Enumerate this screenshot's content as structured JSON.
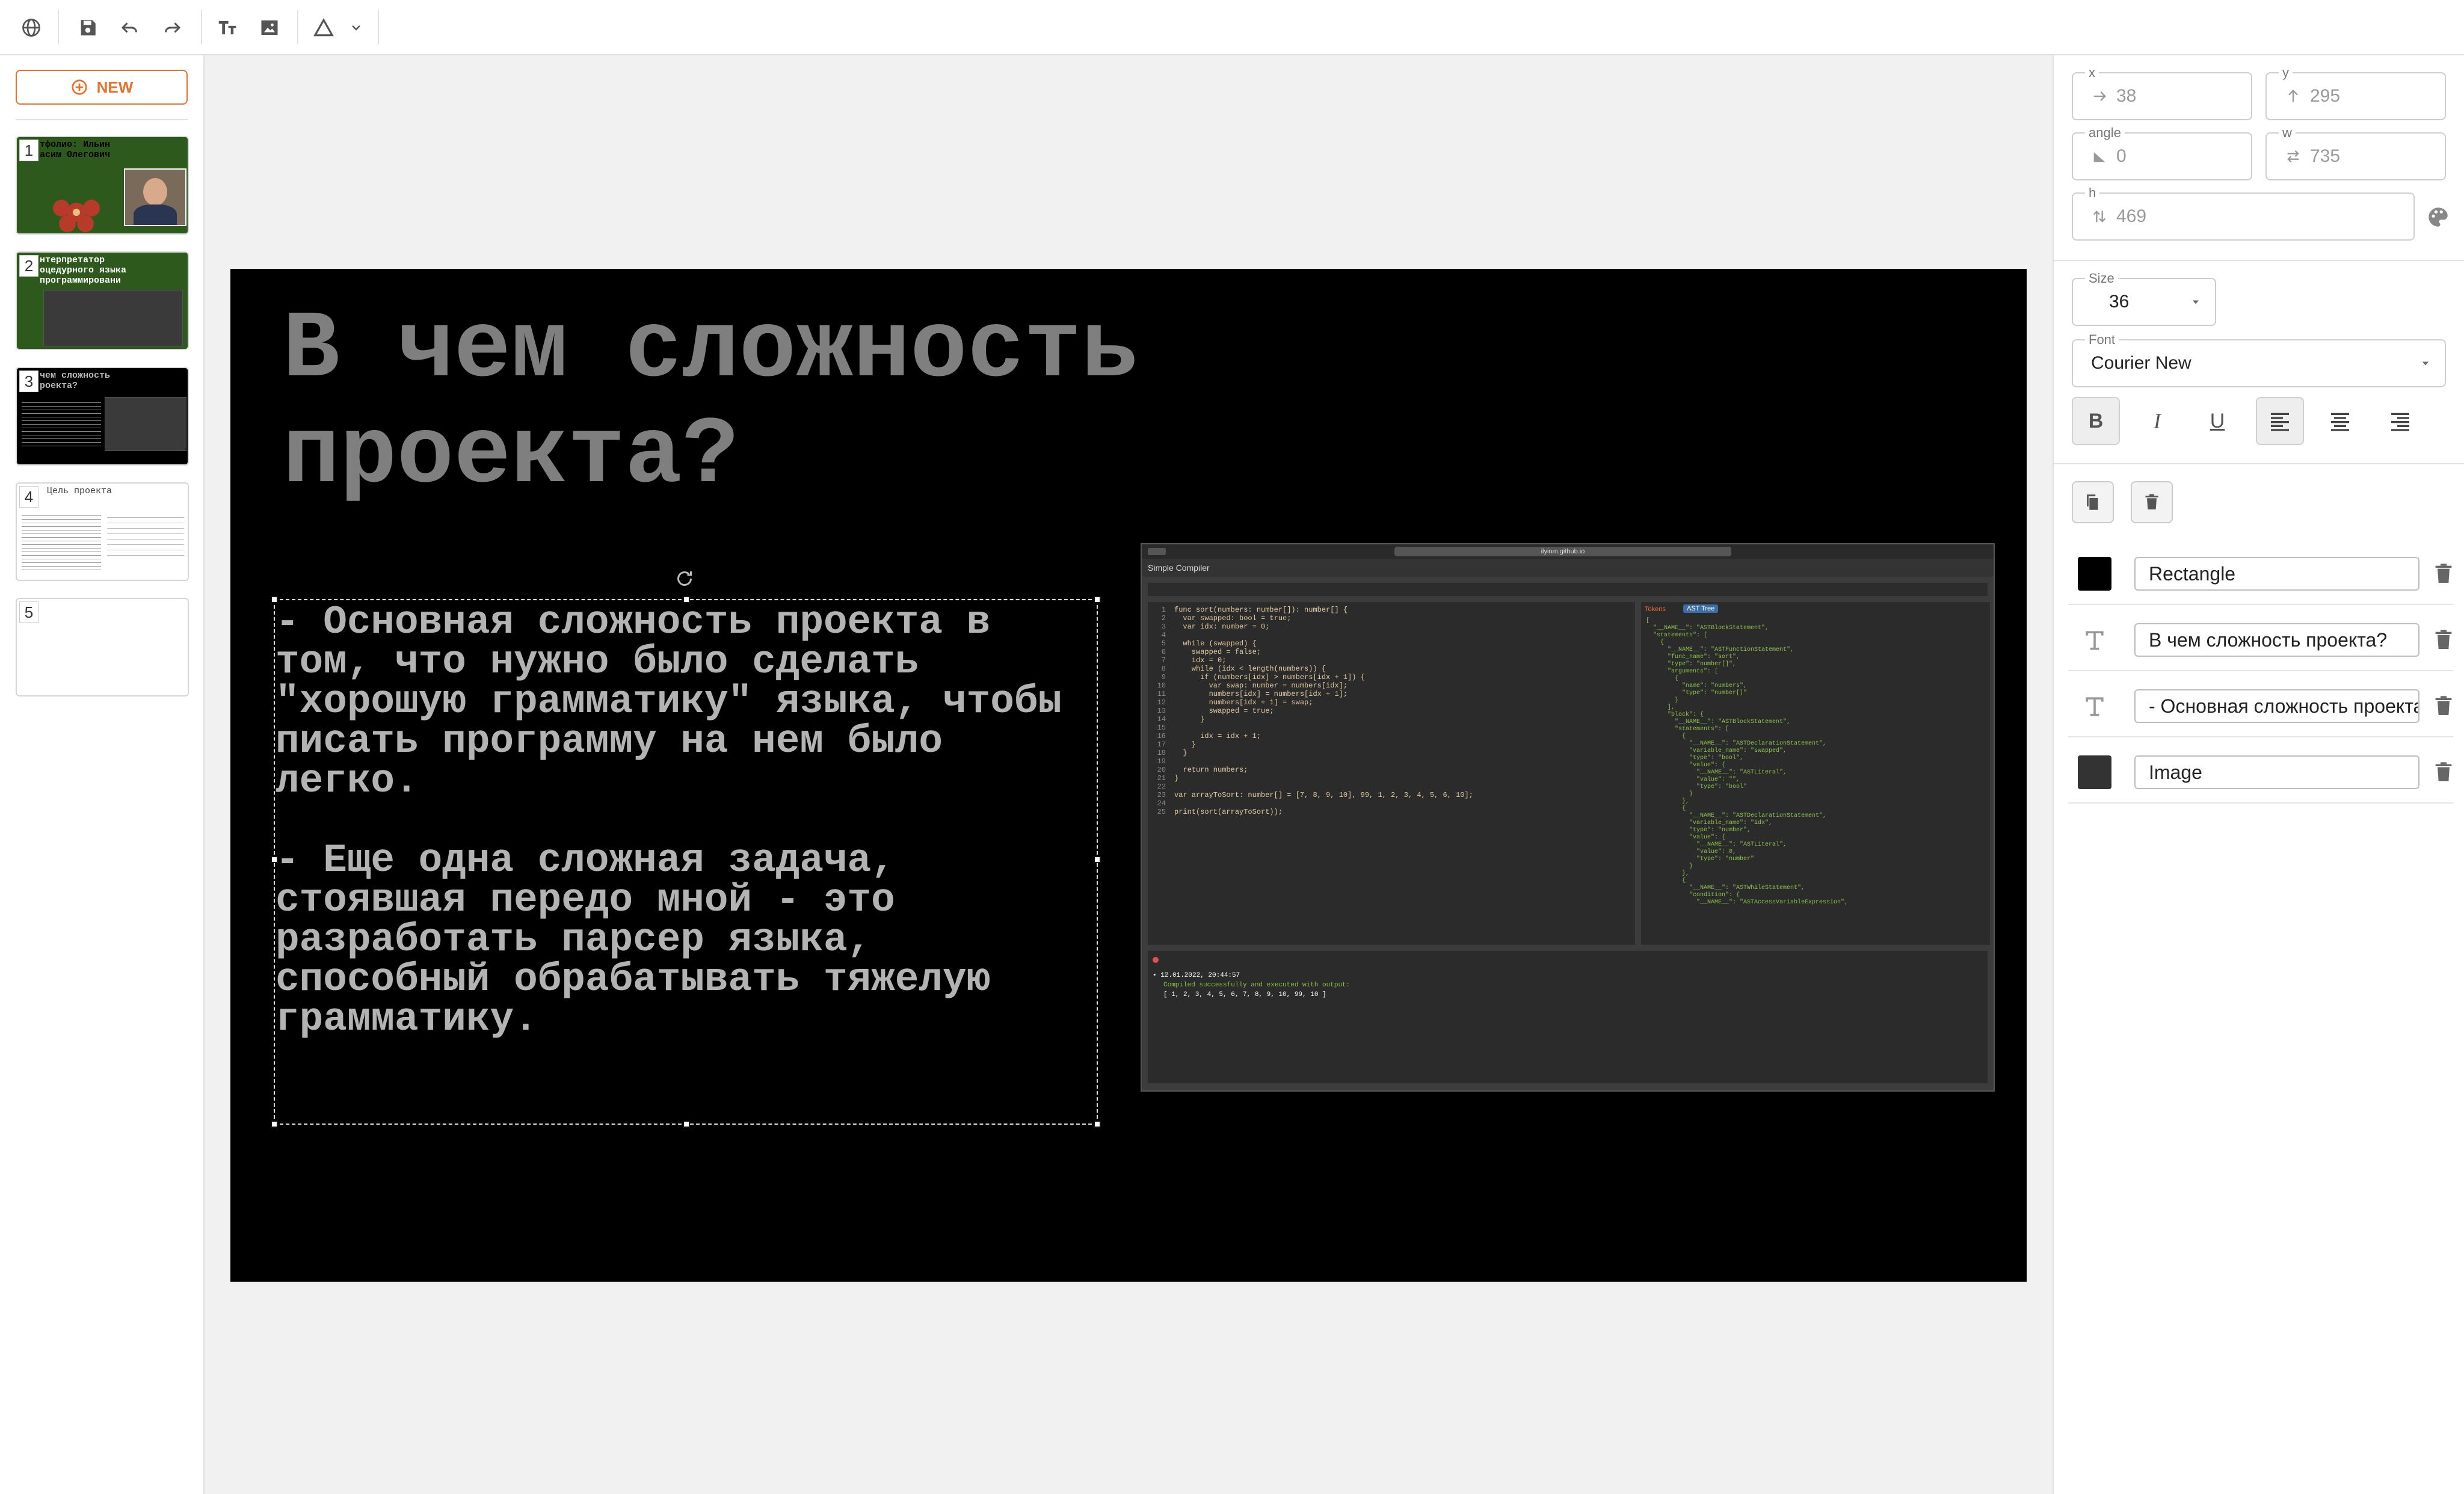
{
  "toolbar": {
    "icons": [
      "globe-icon",
      "save-icon",
      "undo-icon",
      "redo-icon",
      "text-icon",
      "image-icon",
      "shape-icon",
      "chevron-down-icon"
    ]
  },
  "sidebar": {
    "new_label": "NEW",
    "slides": [
      {
        "number": "1",
        "title": "тфолио: Ильин\nасим Олегович",
        "bg": "#2d5a1c"
      },
      {
        "number": "2",
        "title": "нтерпретатор\nоцедурного языка\nпрограммировани",
        "bg": "#2d5a1c"
      },
      {
        "number": "3",
        "title": "чем сложность\nроекта?",
        "bg": "#000000"
      },
      {
        "number": "4",
        "title": "Цель проекта",
        "bg": "#ffffff"
      },
      {
        "number": "5",
        "title": "",
        "bg": "#ffffff"
      }
    ]
  },
  "slide": {
    "title": "В чем сложность\nпроекта?",
    "body": "- Основная сложность проекта в\nтом, что нужно было сделать\n\"хорошую грамматику\" языка, чтобы\nписать программу на нем было\nлегко.\n\n- Еще одна сложная задача,\nстоявшая передо мной - это\nразработать парсер языка,\nспособный обрабатывать тяжелую\nграмматику.",
    "background": "#000000",
    "title_color": "#7f7f7f",
    "body_color": "#b3b3b3"
  },
  "screenshot": {
    "url": "ilyinm.github.io",
    "app_title": "Simple Compiler",
    "tab_tokens": "Tokens",
    "tab_ast": "AST Tree",
    "line_numbers": "1\n2\n3\n4\n5\n6\n7\n8\n9\n10\n11\n12\n13\n14\n15\n16\n17\n18\n19\n20\n21\n22\n23\n24\n25",
    "code": "func sort(numbers: number[]): number[] {\n  var swapped: bool = true;\n  var idx: number = 0;\n\n  while (swapped) {\n    swapped = false;\n    idx = 0;\n    while (idx < length(numbers)) {\n      if (numbers[idx] > numbers[idx + 1]) {\n        var swap: number = numbers[idx];\n        numbers[idx] = numbers[idx + 1];\n        numbers[idx + 1] = swap;\n        swapped = true;\n      }\n\n      idx = idx + 1;\n    }\n  }\n\n  return numbers;\n}\n\nvar arrayToSort: number[] = [7, 8, 9, 10], 99, 1, 2, 3, 4, 5, 6, 10];\n\nprint(sort(arrayToSort));",
    "ast": "[\n  \"__NAME__\": \"ASTBlockStatement\",\n  \"statements\": [\n    {\n      \"__NAME__\": \"ASTFunctionStatement\",\n      \"func_name\": \"sort\",\n      \"type\": \"number[]\",\n      \"arguments\": [\n        {\n          \"name\": \"numbers\",\n          \"type\": \"number[]\"\n        }\n      ],\n      \"block\": {\n        \"__NAME__\": \"ASTBlockStatement\",\n        \"statements\": [\n          {\n            \"__NAME__\": \"ASTDeclarationStatement\",\n            \"variable_name\": \"swapped\",\n            \"type\": \"bool\",\n            \"value\": {\n              \"__NAME__\": \"ASTLiteral\",\n              \"value\": \"\",\n              \"type\": \"bool\"\n            }\n          },\n          {\n            \"__NAME__\": \"ASTDeclarationStatement\",\n            \"variable_name\": \"idx\",\n            \"type\": \"number\",\n            \"value\": {\n              \"__NAME__\": \"ASTLiteral\",\n              \"value\": 0,\n              \"type\": \"number\"\n            }\n          },\n          {\n            \"__NAME__\": \"ASTWhileStatement\",\n            \"condition\": {\n              \"__NAME__\": \"ASTAccessVariableExpression\",",
    "console_time": "• 12.01.2022, 20:44:57",
    "console_msg": "Compiled successfully and executed with output:",
    "console_out": "[ 1, 2, 3, 4, 5, 6, 7, 8, 9, 10, 99, 10 ]"
  },
  "props": {
    "x_label": "x",
    "x_value": "38",
    "y_label": "y",
    "y_value": "295",
    "angle_label": "angle",
    "angle_value": "0",
    "w_label": "w",
    "w_value": "735",
    "h_label": "h",
    "h_value": "469",
    "size_label": "Size",
    "size_value": "36",
    "font_label": "Font",
    "font_value": "Courier New",
    "bold": "B",
    "italic": "I",
    "underline": "U"
  },
  "layers": [
    {
      "name": "Rectangle",
      "kind": "rectangle",
      "swatch": "#000000"
    },
    {
      "name": "В чем сложность проекта?",
      "kind": "text"
    },
    {
      "name": "- Основная сложность проекта в",
      "kind": "text"
    },
    {
      "name": "Image",
      "kind": "image",
      "swatch": "#333333"
    }
  ],
  "colors": {
    "accent": "#e8722c",
    "selected_format": "#e0e0e0"
  }
}
